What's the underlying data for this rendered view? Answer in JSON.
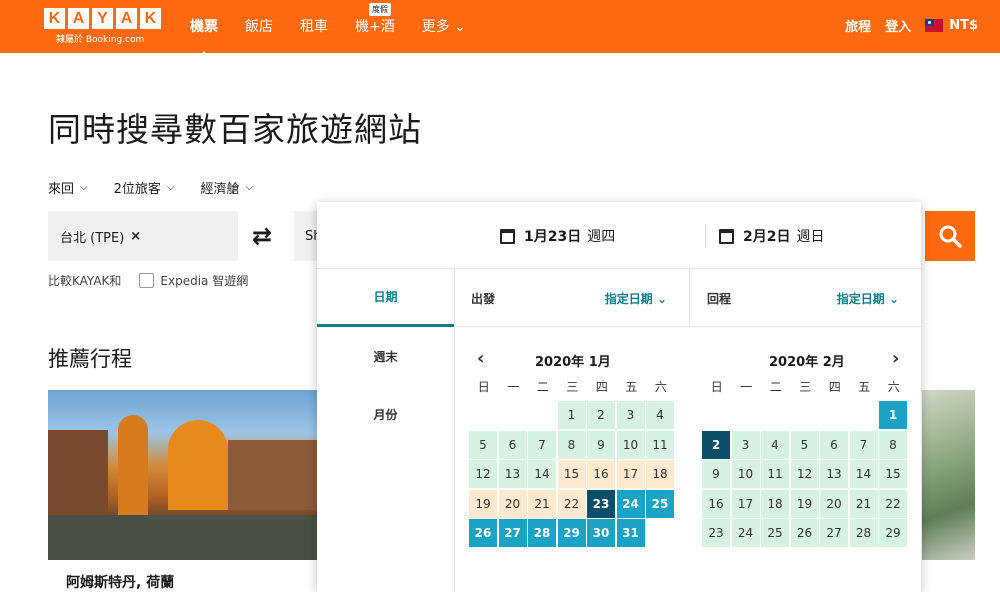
{
  "header": {
    "logo_letters": [
      "K",
      "A",
      "Y",
      "A",
      "K"
    ],
    "logo_sub": "隸屬於 Booking.com",
    "nav": [
      {
        "label": "機票",
        "active": true
      },
      {
        "label": "飯店"
      },
      {
        "label": "租車"
      },
      {
        "label": "機+酒",
        "badge": "度假"
      },
      {
        "label": "更多 ⌄"
      }
    ],
    "trips": "旅程",
    "login": "登入",
    "currency": "NT$"
  },
  "headline": "同時搜尋數百家旅遊網站",
  "options": {
    "trip_type": "來回",
    "travelers": "2位旅客",
    "cabin": "經濟艙"
  },
  "search": {
    "origin": "台北 (TPE)",
    "origin_clear": "×",
    "dest_partial": "Sh"
  },
  "compare": {
    "label": "比較KAYAK和",
    "site": "Expedia 智遊網"
  },
  "recommended": {
    "title": "推薦行程",
    "caption": "阿姆斯特丹, 荷蘭"
  },
  "calendar": {
    "depart_date": "1月23日",
    "depart_weekday": "週四",
    "return_date": "2月2日",
    "return_weekday": "週日",
    "tabs": [
      "日期",
      "週末",
      "月份"
    ],
    "depart_label": "出發",
    "return_label": "回程",
    "flex_select": "指定日期 ⌄",
    "month1": "2020年 1月",
    "month2": "2020年 2月",
    "weekdays": [
      "日",
      "一",
      "二",
      "三",
      "四",
      "五",
      "六"
    ],
    "jan": [
      [
        "",
        "e"
      ],
      [
        "",
        "e"
      ],
      [
        "",
        "e"
      ],
      [
        "1",
        "g"
      ],
      [
        "2",
        "g"
      ],
      [
        "3",
        "g"
      ],
      [
        "4",
        "g"
      ],
      [
        "5",
        "g"
      ],
      [
        "6",
        "g"
      ],
      [
        "7",
        "g"
      ],
      [
        "8",
        "g"
      ],
      [
        "9",
        "g"
      ],
      [
        "10",
        "g"
      ],
      [
        "11",
        "g"
      ],
      [
        "12",
        "g"
      ],
      [
        "13",
        "g"
      ],
      [
        "14",
        "g"
      ],
      [
        "15",
        "o"
      ],
      [
        "16",
        "o"
      ],
      [
        "17",
        "o"
      ],
      [
        "18",
        "o"
      ],
      [
        "19",
        "o"
      ],
      [
        "20",
        "o"
      ],
      [
        "21",
        "o"
      ],
      [
        "22",
        "o"
      ],
      [
        "23",
        "sel"
      ],
      [
        "24",
        "b"
      ],
      [
        "25",
        "b"
      ],
      [
        "26",
        "b"
      ],
      [
        "27",
        "b"
      ],
      [
        "28",
        "b"
      ],
      [
        "29",
        "b"
      ],
      [
        "30",
        "b"
      ],
      [
        "31",
        "b"
      ],
      [
        "",
        "e"
      ]
    ],
    "feb": [
      [
        "",
        "e"
      ],
      [
        "",
        "e"
      ],
      [
        "",
        "e"
      ],
      [
        "",
        "e"
      ],
      [
        "",
        "e"
      ],
      [
        "",
        "e"
      ],
      [
        "1",
        "b"
      ],
      [
        "2",
        "sel"
      ],
      [
        "3",
        "g"
      ],
      [
        "4",
        "g"
      ],
      [
        "5",
        "g"
      ],
      [
        "6",
        "g"
      ],
      [
        "7",
        "g"
      ],
      [
        "8",
        "g"
      ],
      [
        "9",
        "g"
      ],
      [
        "10",
        "g"
      ],
      [
        "11",
        "g"
      ],
      [
        "12",
        "g"
      ],
      [
        "13",
        "g"
      ],
      [
        "14",
        "g"
      ],
      [
        "15",
        "g"
      ],
      [
        "16",
        "g"
      ],
      [
        "17",
        "g"
      ],
      [
        "18",
        "g"
      ],
      [
        "19",
        "g"
      ],
      [
        "20",
        "g"
      ],
      [
        "21",
        "g"
      ],
      [
        "22",
        "g"
      ],
      [
        "23",
        "g"
      ],
      [
        "24",
        "g"
      ],
      [
        "25",
        "g"
      ],
      [
        "26",
        "g"
      ],
      [
        "27",
        "g"
      ],
      [
        "28",
        "g"
      ],
      [
        "29",
        "g"
      ]
    ]
  }
}
